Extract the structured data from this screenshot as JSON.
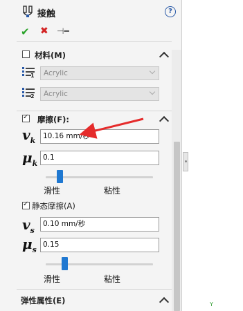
{
  "header": {
    "title": "接触",
    "help": "?",
    "ok_icon": "check-icon",
    "cancel_icon": "x-icon",
    "pin_icon": "pushpin-icon"
  },
  "material": {
    "label": "材料(M)",
    "checked": false,
    "select1_value": "Acrylic",
    "select1_num": "1",
    "select2_value": "Acrylic",
    "select2_num": "2"
  },
  "friction": {
    "label": "摩擦(F):",
    "checked": true,
    "vk_symbol": "v",
    "vk_sub": "k",
    "vk_value": "10.16 mm/秒",
    "muk_symbol": "μ",
    "muk_sub": "k",
    "muk_value": "0.1",
    "slider1_fraction": 0.13,
    "slider_left_label": "滑性",
    "slider_right_label": "粘性",
    "static_label": "静态摩擦(A)",
    "static_checked": true,
    "vs_symbol": "v",
    "vs_sub": "s",
    "vs_value": "0.10 mm/秒",
    "mus_symbol": "μ",
    "mus_sub": "s",
    "mus_value": "0.15",
    "slider2_fraction": 0.18
  },
  "elastic": {
    "label": "弹性属性(E)"
  },
  "viewport": {
    "axis_label": "Y"
  },
  "colors": {
    "accent": "#1f78d1",
    "ok": "#27a227",
    "cancel": "#d32424",
    "annotation_arrow": "#e52b2b"
  }
}
